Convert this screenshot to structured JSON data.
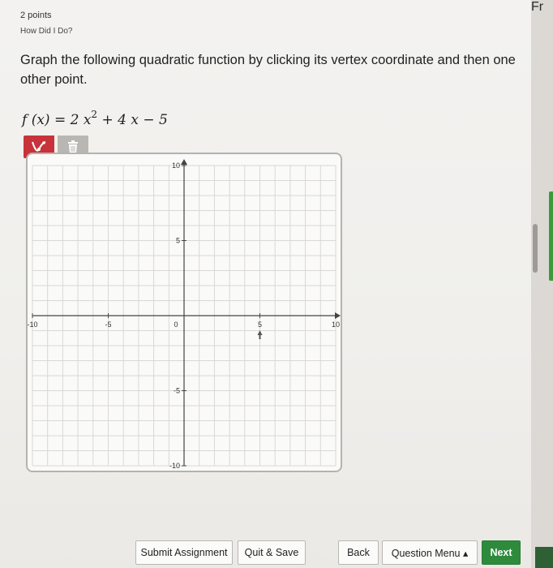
{
  "header": {
    "points": "2 points",
    "how_did_i_do": "How Did I Do?"
  },
  "question": {
    "prompt": "Graph the following quadratic function by clicking its vertex coordinate and then one other point.",
    "formula": {
      "lhs": "f (x) = 2 x",
      "exp": "2",
      "rhs": " + 4 x − 5"
    }
  },
  "toolbar": {
    "draw_icon": "parabola-tool-icon",
    "trash_icon": "trash-icon"
  },
  "graph": {
    "x_ticks": [
      "-10",
      "-5",
      "0",
      "5",
      "10"
    ],
    "y_ticks": [
      "10",
      "5",
      "-5",
      "-10"
    ],
    "range": [
      -10,
      10
    ]
  },
  "buttons": {
    "submit": "Submit Assignment",
    "quit": "Quit & Save",
    "back": "Back",
    "menu": "Question Menu ▴",
    "next": "Next"
  },
  "corner_text": "Fr"
}
